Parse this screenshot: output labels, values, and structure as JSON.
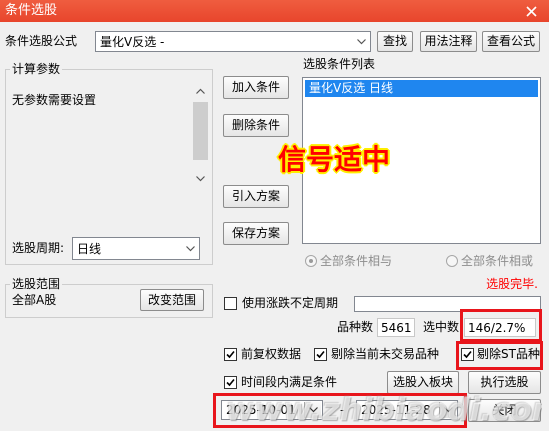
{
  "window": {
    "title": "条件选股"
  },
  "formula": {
    "label": "条件选股公式",
    "value": "量化V反选  -",
    "find": "查找",
    "usage": "用法注释",
    "view": "查看公式"
  },
  "params": {
    "title": "计算参数",
    "empty": "无参数需要设置",
    "period_label": "选股周期:",
    "period_value": "日线"
  },
  "actions": {
    "add": "加入条件",
    "remove": "删除条件",
    "import": "引入方案",
    "save": "保存方案"
  },
  "conditions": {
    "title": "选股条件列表",
    "items": [
      "量化V反选  日线"
    ],
    "mode_and": "全部条件相与",
    "mode_or": "全部条件相或",
    "mode": "and"
  },
  "overlay_text": "信号适中",
  "status": "选股完毕.",
  "scope": {
    "title": "选股范围",
    "value": "全部A股",
    "change": "改变范围"
  },
  "options": {
    "variable_period": {
      "label": "使用涨跌不定周期",
      "checked": false
    },
    "forward_adjusted": {
      "label": "前复权数据",
      "checked": true
    },
    "exclude_untraded": {
      "label": "剔除当前未交易品种",
      "checked": true
    },
    "exclude_st": {
      "label": "剔除ST品种",
      "checked": true
    },
    "period_match": {
      "label": "时间段内满足条件",
      "checked": true
    }
  },
  "stats": {
    "total_label": "品种数",
    "total_value": "5461",
    "selected_label": "选中数",
    "selected_value": "146/2.7%"
  },
  "date_range": {
    "start": "2025-10-01",
    "separator": "-",
    "end": "2025-11-28"
  },
  "buttons": {
    "to_block": "选股入板块",
    "run": "执行选股",
    "close": "关闭"
  },
  "watermark": "www.zhibiaodi.com",
  "icons": {
    "close": "close-icon",
    "dropdown": "chevron-down-icon",
    "scroll_up": "chevron-up-icon",
    "scroll_down": "chevron-down-icon",
    "check": "check-icon"
  },
  "colors": {
    "title_bar": "#e8452c",
    "highlight": "#e8151b",
    "selection": "#1f86ef",
    "status": "#ff0000",
    "overlay_text": "#ff0000",
    "overlay_stroke": "#ffee00"
  }
}
